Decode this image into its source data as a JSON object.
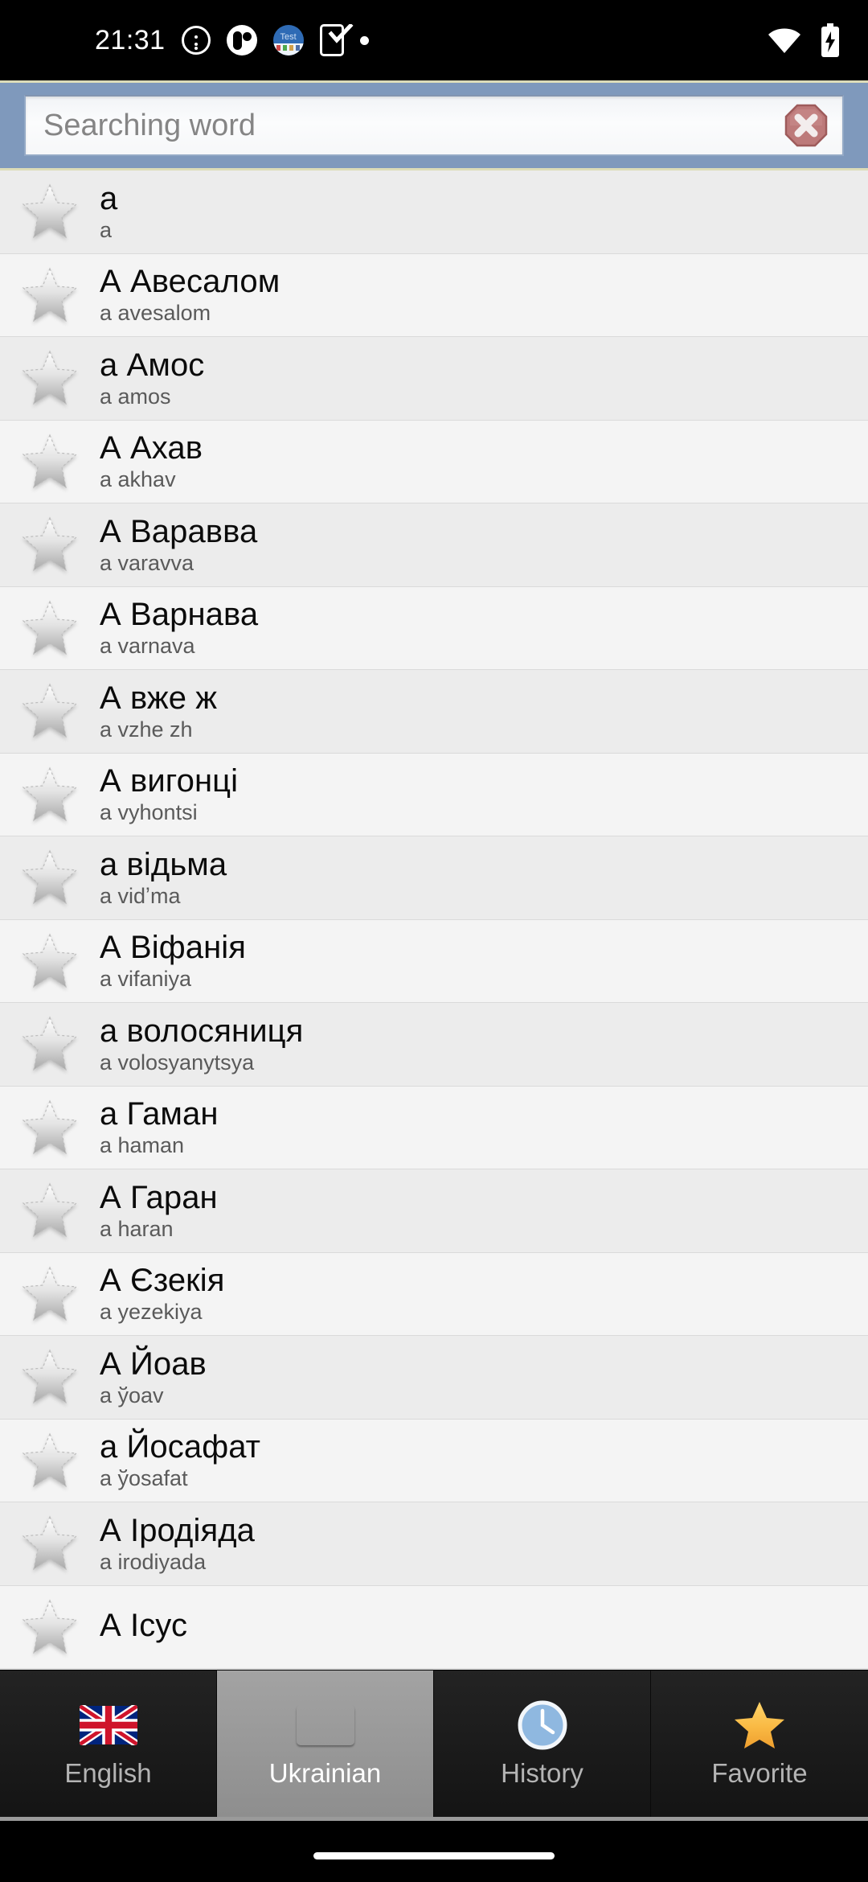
{
  "status_bar": {
    "time": "21:31",
    "left_icons": [
      {
        "name": "info-icon",
        "label": "info"
      },
      {
        "name": "contact-icon",
        "label": "contact"
      },
      {
        "name": "test-badge-icon",
        "label": "Test"
      },
      {
        "name": "phone-check-icon",
        "label": "device check"
      },
      {
        "name": "notification-dot-icon",
        "label": "dot"
      }
    ],
    "right_icons": [
      {
        "name": "wifi-icon",
        "label": "wifi"
      },
      {
        "name": "battery-charging-icon",
        "label": "battery charging"
      }
    ]
  },
  "search": {
    "placeholder": "Searching word",
    "value": "",
    "clear_label": "clear",
    "bar_color": "#7f99bc",
    "border_color": "#dcdcb8"
  },
  "list": {
    "items": [
      {
        "term": "a",
        "translit": "a"
      },
      {
        "term": "А Авесалом",
        "translit": "a avesalom"
      },
      {
        "term": "а Амос",
        "translit": "a amos"
      },
      {
        "term": "А Ахав",
        "translit": "a akhav"
      },
      {
        "term": "А Варавва",
        "translit": "a varavva"
      },
      {
        "term": "А Варнава",
        "translit": "a varnava"
      },
      {
        "term": "А вже ж",
        "translit": "a vzhe zh"
      },
      {
        "term": "А вигонці",
        "translit": "a vyhontsi"
      },
      {
        "term": "а відьма",
        "translit": "a vidʼma"
      },
      {
        "term": "А Віфанія",
        "translit": "a vifaniya"
      },
      {
        "term": "а волосяниця",
        "translit": "a volosyanytsya"
      },
      {
        "term": "а Гаман",
        "translit": "a haman"
      },
      {
        "term": "А Гаран",
        "translit": "a haran"
      },
      {
        "term": "А Єзекія",
        "translit": "a yezekiya"
      },
      {
        "term": "А Йоав",
        "translit": "a ўoav"
      },
      {
        "term": "а Йосафат",
        "translit": "a ўosafat"
      },
      {
        "term": "А Іродіяда",
        "translit": "a irodiyada"
      },
      {
        "term": "А Ісус",
        "translit": ""
      }
    ]
  },
  "tabs": [
    {
      "label": "English",
      "icon": "uk-flag-icon",
      "selected": false
    },
    {
      "label": "Ukrainian",
      "icon": "ua-flag-icon",
      "selected": true
    },
    {
      "label": "History",
      "icon": "clock-icon",
      "selected": false
    },
    {
      "label": "Favorite",
      "icon": "gold-star-icon",
      "selected": false
    }
  ],
  "colors": {
    "header": "#7f99bc",
    "header_border": "#dcdcb8",
    "list_odd": "#ececec",
    "list_even": "#f4f4f4",
    "tab_selected": "#9a9a9a",
    "clear_button": "#bd6f6f"
  }
}
